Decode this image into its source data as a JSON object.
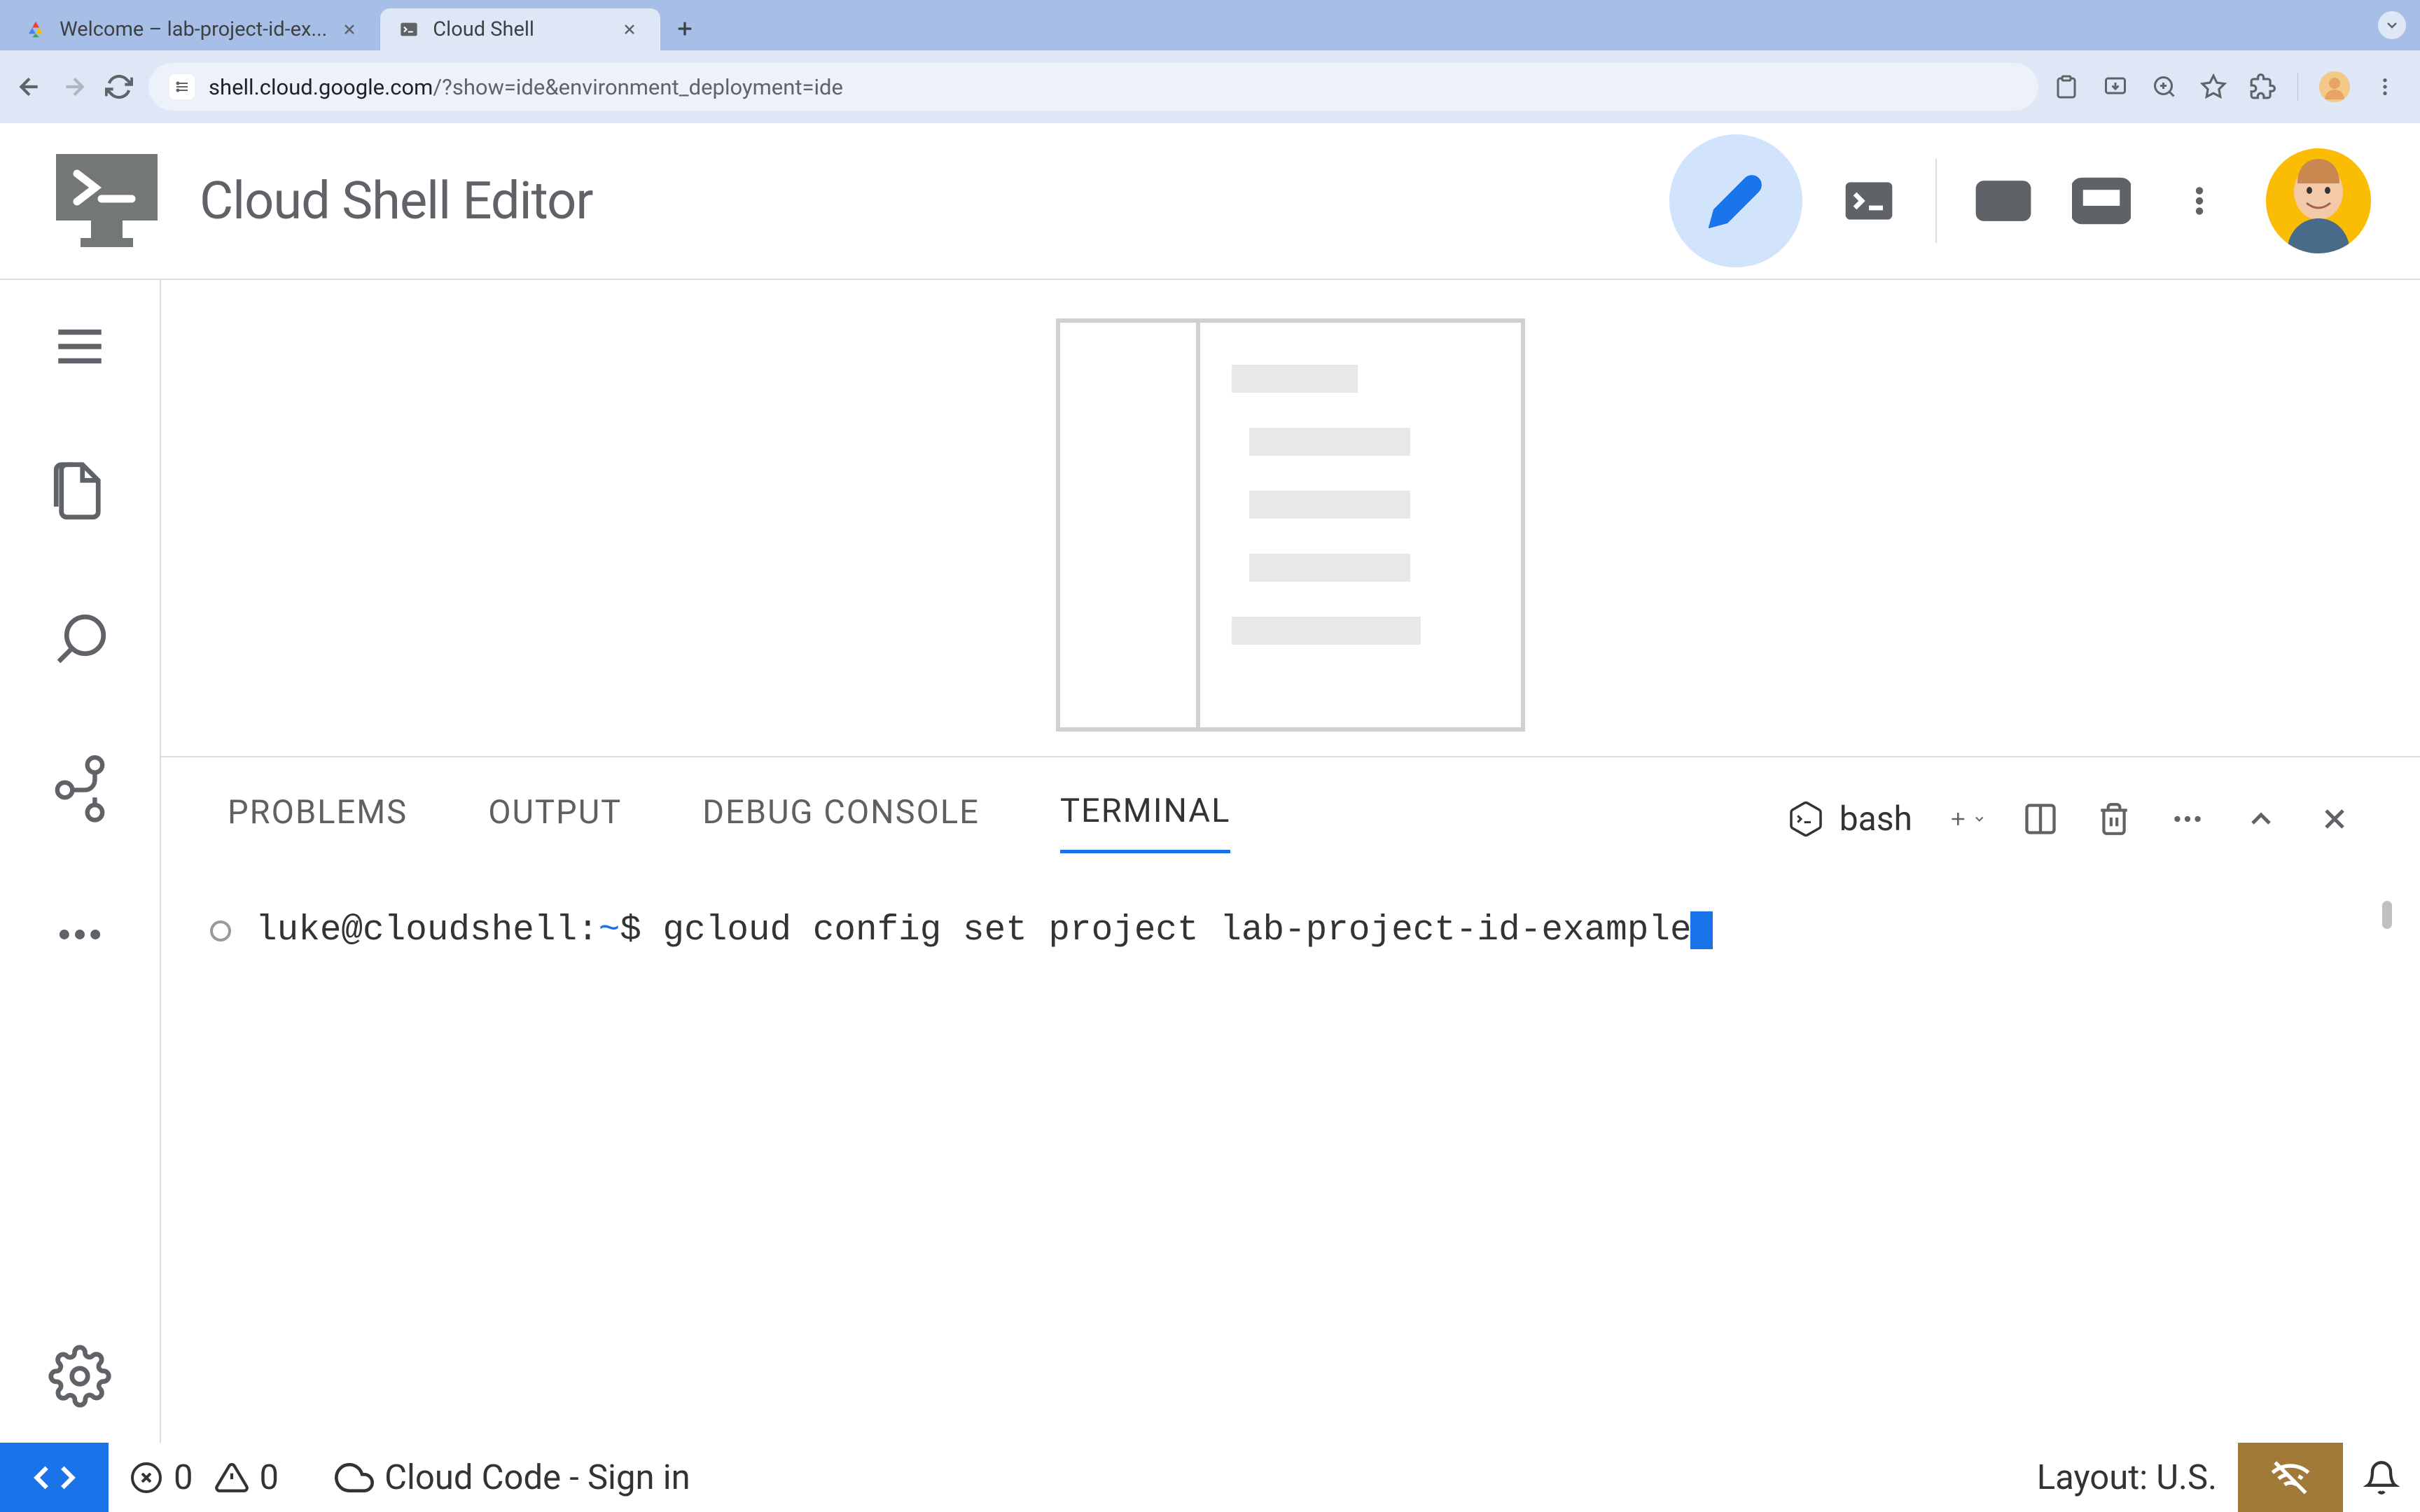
{
  "browser": {
    "tabs": [
      {
        "title": "Welcome – lab-project-id-ex...",
        "active": false
      },
      {
        "title": "Cloud Shell",
        "active": true
      }
    ],
    "url": "shell.cloud.google.com/?show=ide&environment_deployment=ide",
    "url_host": "shell.cloud.google.com",
    "url_path": "/?show=ide&environment_deployment=ide"
  },
  "header": {
    "title": "Cloud Shell Editor"
  },
  "panel": {
    "tabs": {
      "problems": "PROBLEMS",
      "output": "OUTPUT",
      "debug_console": "DEBUG CONSOLE",
      "terminal": "TERMINAL"
    },
    "shell_name": "bash"
  },
  "terminal": {
    "prompt_user": "luke@cloudshell:",
    "prompt_path": "~",
    "prompt_symbol": "$ ",
    "command": "gcloud config set project lab-project-id-example"
  },
  "status": {
    "errors": "0",
    "warnings": "0",
    "cloud_code": "Cloud Code - Sign in",
    "layout": "Layout: U.S."
  }
}
